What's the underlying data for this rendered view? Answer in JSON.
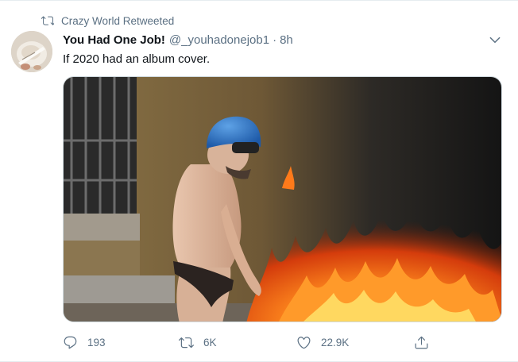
{
  "retweet": {
    "icon": "retweet-icon",
    "label": "Crazy World Retweeted"
  },
  "author": {
    "display_name": "You Had One Job!",
    "handle": "@_youhadonejob1",
    "separator": "·",
    "time": "8h"
  },
  "tweet": {
    "text": "If 2020 had an album cover."
  },
  "actions": {
    "reply_count": "193",
    "retweet_count": "6K",
    "like_count": "22.9K"
  },
  "colors": {
    "secondary_text": "#5b7083",
    "primary_text": "#0f1419"
  }
}
